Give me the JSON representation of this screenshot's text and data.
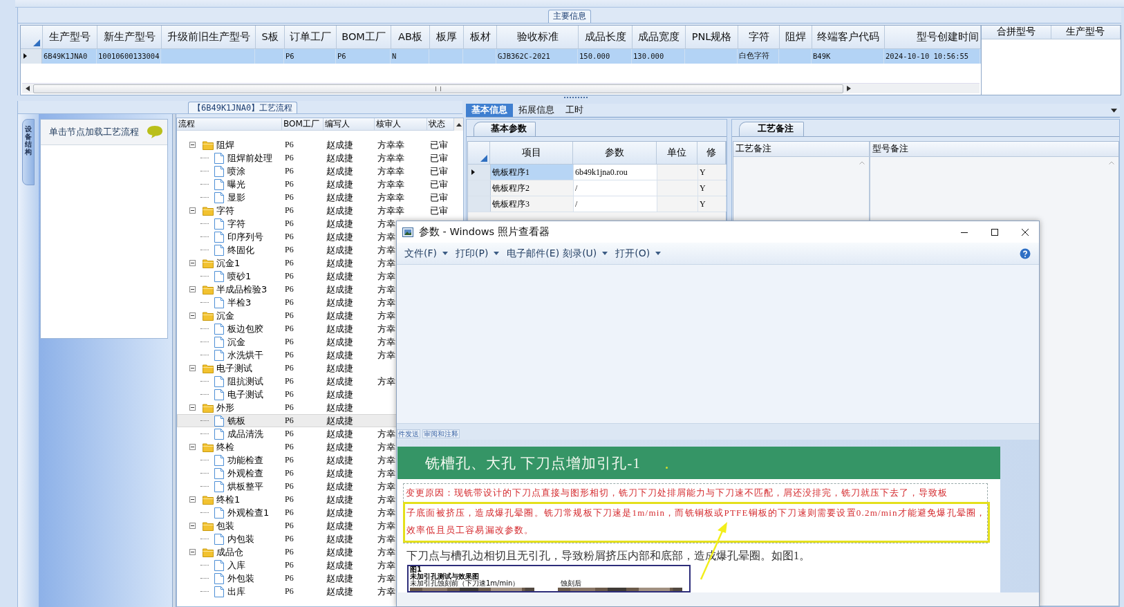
{
  "main_info": {
    "title": "主要信息",
    "columns": [
      "生产型号",
      "新生产型号",
      "升级前旧生产型号",
      "S板",
      "订单工厂",
      "BOM工厂",
      "AB板",
      "板厚",
      "板材",
      "验收标准",
      "成品长度",
      "成品宽度",
      "PNL规格",
      "字符",
      "阻焊",
      "终端客户代码",
      "型号创建时间"
    ],
    "rows": [
      {
        "selected": true,
        "cells": [
          "6B49K1JNA0",
          "10010600133004",
          "",
          "",
          "P6",
          "P6",
          "N",
          "",
          "",
          "GJB362C-2021",
          "150.000",
          "130.000",
          "",
          "白色字符",
          "",
          "B49K",
          "2024-10-10 10:56:55"
        ]
      }
    ]
  },
  "merge_grid": {
    "columns": [
      "合拼型号",
      "生产型号"
    ]
  },
  "process_panel": {
    "title": "【6B49K1JNA0】工艺流程",
    "side_tab": "设备结构",
    "node_hint": "单击节点加载工艺流程",
    "tree_columns": [
      "流程",
      "BOM工厂",
      "编写人",
      "核审人",
      "状态"
    ],
    "tree": [
      {
        "name": "阻焊",
        "kind": "folder",
        "expanded": true,
        "selected": false,
        "bom": "P6",
        "writer": "赵成捷",
        "reviewer": "方幸幸",
        "status": "已审",
        "children": [
          {
            "name": "阻焊前处理",
            "kind": "step",
            "selected": false,
            "bom": "P6",
            "writer": "赵成捷",
            "reviewer": "方幸幸",
            "status": "已审"
          },
          {
            "name": "喷涂",
            "kind": "step",
            "selected": false,
            "bom": "P6",
            "writer": "赵成捷",
            "reviewer": "方幸幸",
            "status": "已审"
          },
          {
            "name": "曝光",
            "kind": "step",
            "selected": false,
            "bom": "P6",
            "writer": "赵成捷",
            "reviewer": "方幸幸",
            "status": "已审"
          },
          {
            "name": "显影",
            "kind": "step",
            "selected": false,
            "bom": "P6",
            "writer": "赵成捷",
            "reviewer": "方幸幸",
            "status": "已审"
          }
        ]
      },
      {
        "name": "字符",
        "kind": "folder",
        "expanded": true,
        "selected": false,
        "bom": "P6",
        "writer": "赵成捷",
        "reviewer": "方幸幸",
        "status": "已审",
        "children": [
          {
            "name": "字符",
            "kind": "step",
            "selected": false,
            "bom": "P6",
            "writer": "赵成捷",
            "reviewer": "方幸"
          },
          {
            "name": "印序列号",
            "kind": "step",
            "selected": false,
            "bom": "P6",
            "writer": "赵成捷",
            "reviewer": "方幸"
          },
          {
            "name": "终固化",
            "kind": "step",
            "selected": false,
            "bom": "P6",
            "writer": "赵成捷",
            "reviewer": "方幸"
          }
        ]
      },
      {
        "name": "沉金1",
        "kind": "folder",
        "expanded": true,
        "selected": false,
        "bom": "P6",
        "writer": "赵成捷",
        "reviewer": "方幸",
        "children": [
          {
            "name": "喷砂1",
            "kind": "step",
            "selected": false,
            "bom": "P6",
            "writer": "赵成捷",
            "reviewer": "方幸"
          }
        ]
      },
      {
        "name": "半成品检验3",
        "kind": "folder",
        "expanded": true,
        "selected": false,
        "bom": "P6",
        "writer": "赵成捷",
        "reviewer": "方幸",
        "children": [
          {
            "name": "半检3",
            "kind": "step",
            "selected": false,
            "bom": "P6",
            "writer": "赵成捷",
            "reviewer": "方幸"
          }
        ]
      },
      {
        "name": "沉金",
        "kind": "folder",
        "expanded": true,
        "selected": false,
        "bom": "P6",
        "writer": "赵成捷",
        "reviewer": "方幸",
        "children": [
          {
            "name": "板边包胶",
            "kind": "step",
            "selected": false,
            "bom": "P6",
            "writer": "赵成捷",
            "reviewer": "方幸"
          },
          {
            "name": "沉金",
            "kind": "step",
            "selected": false,
            "bom": "P6",
            "writer": "赵成捷",
            "reviewer": "方幸"
          },
          {
            "name": "水洗烘干",
            "kind": "step",
            "selected": false,
            "bom": "P6",
            "writer": "赵成捷",
            "reviewer": "方幸"
          }
        ]
      },
      {
        "name": "电子测试",
        "kind": "folder",
        "expanded": true,
        "selected": false,
        "bom": "P6",
        "writer": "赵成捷",
        "children": [
          {
            "name": "阻抗测试",
            "kind": "step",
            "selected": false,
            "bom": "P6",
            "writer": "赵成捷",
            "reviewer": "方幸"
          },
          {
            "name": "电子测试",
            "kind": "step",
            "selected": false,
            "bom": "P6",
            "writer": "赵成捷"
          }
        ]
      },
      {
        "name": "外形",
        "kind": "folder",
        "expanded": true,
        "selected": false,
        "bom": "P6",
        "writer": "赵成捷",
        "children": [
          {
            "name": "铣板",
            "kind": "step",
            "selected": true,
            "bom": "P6",
            "writer": "赵成捷"
          },
          {
            "name": "成品清洗",
            "kind": "step",
            "selected": false,
            "bom": "P6",
            "writer": "赵成捷",
            "reviewer": "方幸"
          }
        ]
      },
      {
        "name": "终检",
        "kind": "folder",
        "expanded": true,
        "selected": false,
        "bom": "P6",
        "writer": "赵成捷",
        "reviewer": "方幸",
        "children": [
          {
            "name": "功能检查",
            "kind": "step",
            "selected": false,
            "bom": "P6",
            "writer": "赵成捷",
            "reviewer": "方幸"
          },
          {
            "name": "外观检查",
            "kind": "step",
            "selected": false,
            "bom": "P6",
            "writer": "赵成捷",
            "reviewer": "方幸"
          },
          {
            "name": "烘板整平",
            "kind": "step",
            "selected": false,
            "bom": "P6",
            "writer": "赵成捷",
            "reviewer": "方幸"
          }
        ]
      },
      {
        "name": "终检1",
        "kind": "folder",
        "expanded": true,
        "selected": false,
        "bom": "P6",
        "writer": "赵成捷",
        "reviewer": "方幸",
        "children": [
          {
            "name": "外观检查1",
            "kind": "step",
            "selected": false,
            "bom": "P6",
            "writer": "赵成捷",
            "reviewer": "方幸"
          }
        ]
      },
      {
        "name": "包装",
        "kind": "folder",
        "expanded": true,
        "selected": false,
        "bom": "P6",
        "writer": "赵成捷",
        "reviewer": "方幸",
        "children": [
          {
            "name": "内包装",
            "kind": "step",
            "selected": false,
            "bom": "P6",
            "writer": "赵成捷",
            "reviewer": "方幸"
          }
        ]
      },
      {
        "name": "成品仓",
        "kind": "folder",
        "expanded": true,
        "selected": false,
        "bom": "P6",
        "writer": "赵成捷",
        "reviewer": "方幸",
        "children": [
          {
            "name": "入库",
            "kind": "step",
            "selected": false,
            "bom": "P6",
            "writer": "赵成捷",
            "reviewer": "方幸"
          },
          {
            "name": "外包装",
            "kind": "step",
            "selected": false,
            "bom": "P6",
            "writer": "赵成捷",
            "reviewer": "方幸"
          },
          {
            "name": "出库",
            "kind": "step",
            "selected": false,
            "bom": "P6",
            "writer": "赵成捷",
            "reviewer": "方幸"
          }
        ]
      }
    ]
  },
  "detail_tabs": [
    {
      "label": "基本信息",
      "selected": true
    },
    {
      "label": "拓展信息",
      "selected": false
    },
    {
      "label": "工时",
      "selected": false
    }
  ],
  "basic_params": {
    "tab": "基本参数",
    "columns": [
      "项目",
      "参数",
      "单位",
      "修"
    ],
    "rows": [
      {
        "item": "铣板程序1",
        "param": "6b49k1jna0.rou",
        "modified": "Y",
        "selected": true
      },
      {
        "item": "铣板程序2",
        "param": "/",
        "modified": "Y",
        "selected": false
      },
      {
        "item": "铣板程序3",
        "param": "/",
        "modified": "Y",
        "selected": false
      }
    ]
  },
  "notes": {
    "tab": "工艺备注",
    "columns": [
      "工艺备注",
      "型号备注"
    ]
  },
  "photo_viewer": {
    "title": "参数 - Windows 照片查看器",
    "menu": [
      {
        "label": "文件(F)",
        "dropdown": true
      },
      {
        "label": "打印(P)",
        "dropdown": true
      },
      {
        "label": "电子邮件(E)",
        "dropdown": false
      },
      {
        "label": "刻录(U)",
        "dropdown": true
      },
      {
        "label": "打开(O)",
        "dropdown": true
      }
    ],
    "document": {
      "ribbon": [
        "件发送",
        "审阅和注释"
      ],
      "heading": "铣槽孔、大孔 下刀点增加引孔-1",
      "reason": [
        "变更原因：现铣带设计的下刀点直接与图形相切，铣刀下刀处排屑能力与下刀速不匹配，屑还没排完，铣刀就压下去了，导致板",
        "子底面被挤压，造成爆孔晕圈。铣刀常规板下刀速是1m/min，而铣铜板或PTFE铜板的下刀速则需要设置0.2m/min才能避免爆孔晕圈，效率低且员工容易漏改参数。"
      ],
      "body": "下刀点与槽孔边相切且无引孔，导致粉屑挤压内部和底部，造成爆孔晕圈。如图1。",
      "figure": {
        "number": "图1",
        "title": "未加引孔测试与效果图",
        "captions": [
          "未加引孔蚀刻前（下刀速1m/min）",
          "蚀刻后"
        ]
      }
    }
  }
}
